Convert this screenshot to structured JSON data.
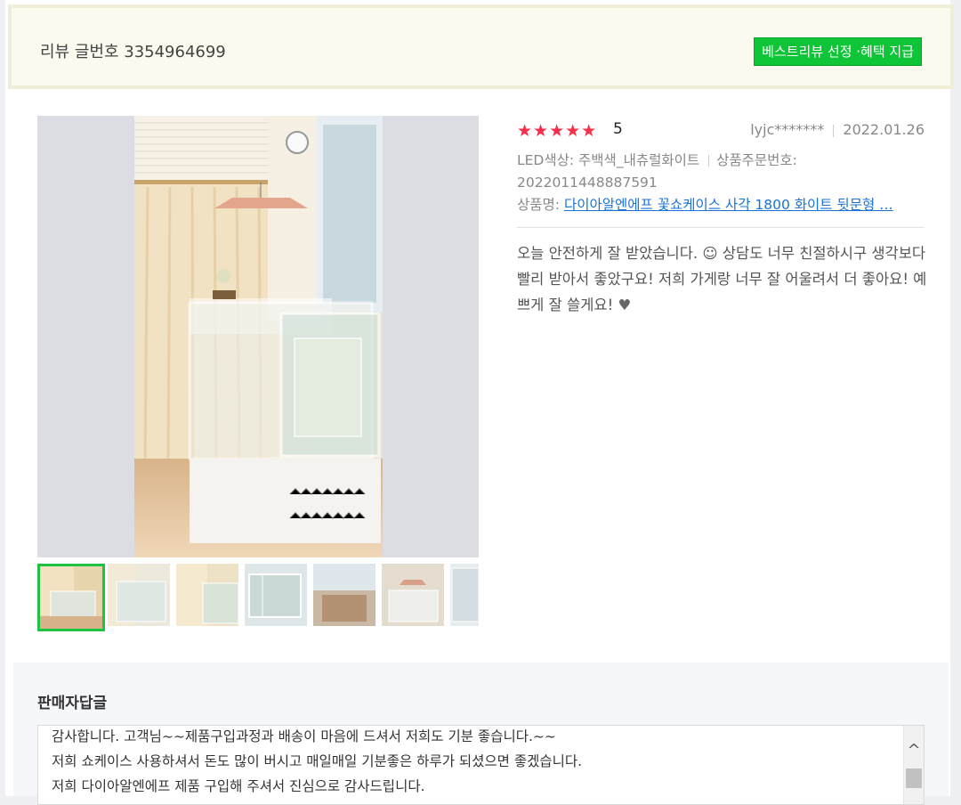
{
  "header": {
    "review_number": "리뷰 글번호 3354964699",
    "best_badge": "베스트리뷰 선정 ·혜택 지급"
  },
  "review": {
    "stars": "★★★★★",
    "rating": "5",
    "reviewer": "lyjc*******",
    "date": "2022.01.26",
    "option": "LED색상: 주백색_내츄럴화이트",
    "order_label": "상품주문번호:",
    "order_number": "2022011448887591",
    "product_label": "상품명:",
    "product_name": "다이아알엔에프 꽃쇼케이스 사각 1800 화이트 뒷문형 …",
    "body": "오늘 안전하게 잘 받았습니다. ☺ 상담도 너무 친절하시구 생각보다 빨리 받아서 좋았구요! 저희 가게랑 너무 잘 어울려서 더 좋아요! 예쁘게 잘 쓸게요! ",
    "heart": "♥"
  },
  "seller_reply": {
    "title": "판매자답글",
    "lines": [
      "감사합니다. 고객님~~제품구입과정과 배송이 마음에 드셔서 저희도 기분 좋습니다.~~",
      "저희 쇼케이스 사용하셔서 돈도 많이 버시고 매일매일 기분좋은 하루가 되셨으면 좋겠습니다.",
      "저희 다이아알엔에프 제품 구입해 주셔서 진심으로 감사드립니다."
    ],
    "scroll_up": "^"
  },
  "colors": {
    "accent_green": "#0ec437",
    "star_red": "#f4304a",
    "link_blue": "#1a73d6"
  },
  "icons": {
    "scroll_up": "chevron-up-icon",
    "rating": "star-icon",
    "heart": "heart-icon"
  }
}
